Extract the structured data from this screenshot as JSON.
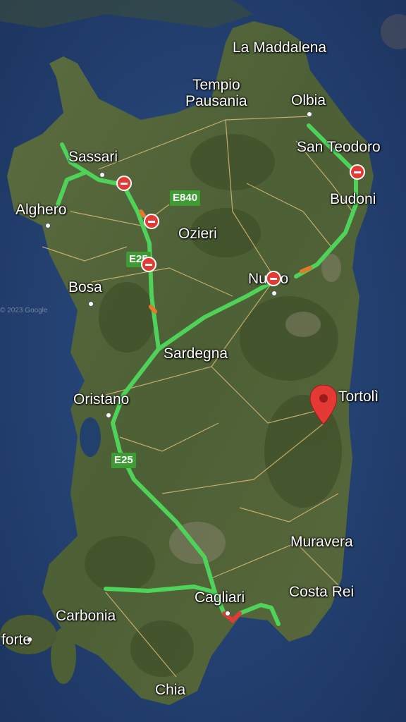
{
  "map": {
    "colors": {
      "sea": "#2a4a7a",
      "land": "#55663a",
      "route": "#4fd25a",
      "closure": "#e53935",
      "pin": "#e53935"
    },
    "cities": {
      "la_maddalena": "La Maddalena",
      "tempio": "Tempio\nPausania",
      "olbia": "Olbia",
      "san_teodoro": "San Teodoro",
      "budoni": "Budoni",
      "sassari": "Sassari",
      "alghero": "Alghero",
      "ozieri": "Ozieri",
      "bosa": "Bosa",
      "nuoro": "Nuoro",
      "sardegna": "Sardegna",
      "oristano": "Oristano",
      "tortoli": "Tortolì",
      "muravera": "Muravera",
      "costa_rei": "Costa Rei",
      "cagliari": "Cagliari",
      "carbonia": "Carbonia",
      "forte": "forte",
      "chia": "Chia"
    },
    "road_shields": {
      "e840": "E840",
      "e25_north": "E25",
      "e25_south": "E25"
    },
    "watermarks": {
      "google_2023": "© 2023 Google"
    },
    "icons": {
      "closure": "road-closed-icon",
      "pin": "location-pin-icon",
      "menu": "overflow-button-icon"
    }
  }
}
